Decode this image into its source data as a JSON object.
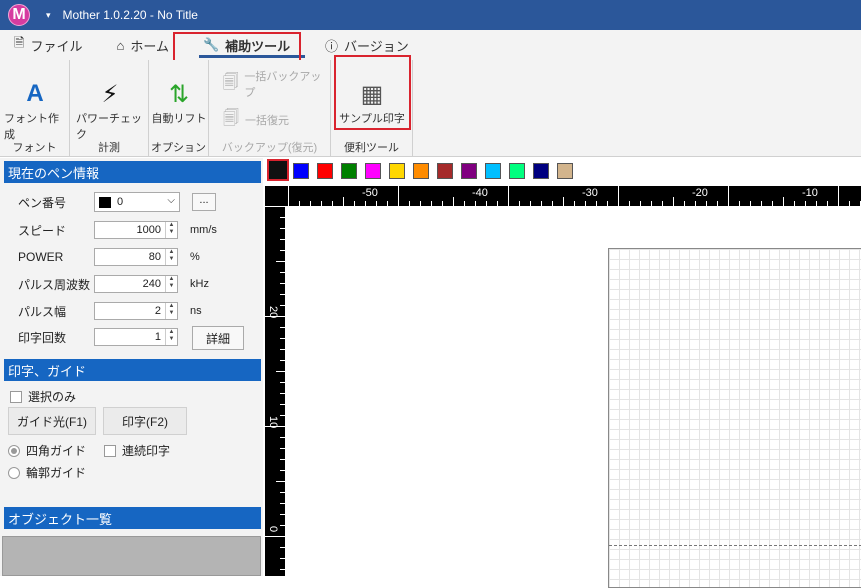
{
  "app": {
    "logo": "M",
    "title": "Mother 1.0.2.20 - No Title"
  },
  "tabs": [
    {
      "label": "ファイル",
      "icon": "document-icon"
    },
    {
      "label": "ホーム",
      "icon": "home-icon"
    },
    {
      "label": "補助ツール",
      "icon": "wrench-icon",
      "active": true
    },
    {
      "label": "バージョン",
      "icon": "info-icon"
    }
  ],
  "ribbon": {
    "groups": {
      "font": "フォント",
      "measure": "計測",
      "option": "オプション",
      "backup": "バックアップ(復元)",
      "tools": "便利ツール"
    },
    "buttons": {
      "font_create": "フォント作成",
      "power_check": "パワーチェック",
      "auto_lift": "自動リフト",
      "backup_all": "一括バックアップ",
      "restore_all": "一括復元",
      "sample_print": "サンプル印字"
    }
  },
  "pen_info": {
    "header": "現在のペン情報",
    "pen_no_label": "ペン番号",
    "pen_no_value": "0",
    "pen_more_button": "...",
    "speed_label": "スピード",
    "speed_value": "1000",
    "speed_unit": "mm/s",
    "power_label": "POWER",
    "power_value": "80",
    "power_unit": "%",
    "freq_label": "パルス周波数",
    "freq_value": "240",
    "freq_unit": "kHz",
    "width_label": "パルス幅",
    "width_value": "2",
    "width_unit": "ns",
    "count_label": "印字回数",
    "count_value": "1",
    "detail_button": "詳細"
  },
  "guide": {
    "header": "印字、ガイド",
    "select_only": "選択のみ",
    "guide_light_button": "ガイド光(F1)",
    "print_button": "印字(F2)",
    "rect_guide": "四角ガイド",
    "continuous_print": "連続印字",
    "outline_guide": "輪郭ガイド"
  },
  "object_list": {
    "header": "オブジェクト一覧"
  },
  "colors": {
    "accent": "#2b579a",
    "highlight": "#d9232e",
    "palette": [
      "#111111",
      "#0000ff",
      "#ff0000",
      "#008000",
      "#ff00ff",
      "#ffd700",
      "#ff8c00",
      "#a52a2a",
      "#800080",
      "#00bfff",
      "#00ff7f",
      "#000080",
      "#d2b48c"
    ]
  },
  "ruler": {
    "top_labels": [
      "-50",
      "-40",
      "-30",
      "-20",
      "-10"
    ],
    "left_labels": [
      "20",
      "10",
      "0"
    ]
  }
}
